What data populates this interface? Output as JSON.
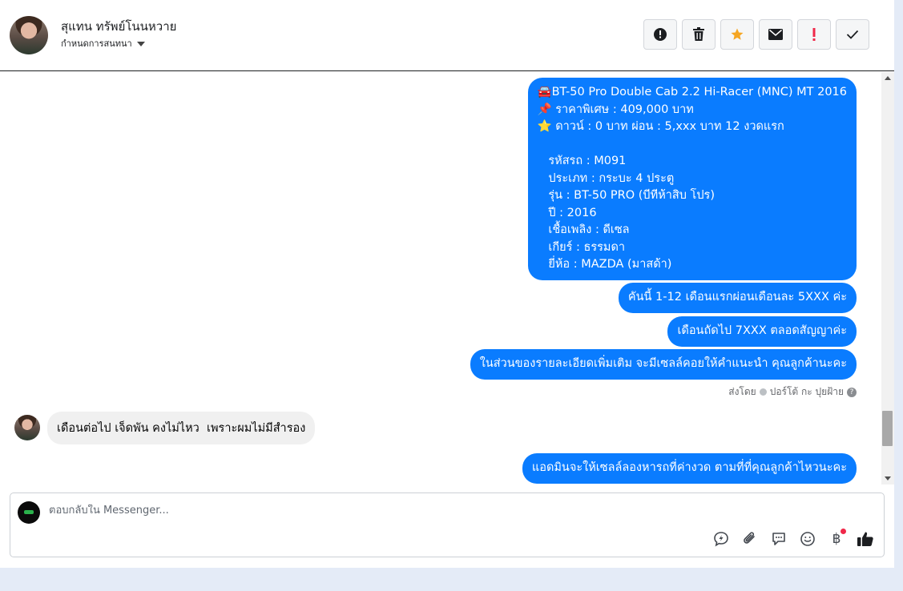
{
  "header": {
    "contact_name": "สุแทน ทรัพย์โนนหวาย",
    "assign_label": "กำหนดการสนทนา"
  },
  "toolbar": {
    "buttons": [
      {
        "name": "spam-button",
        "icon": "!",
        "color": "#1c1e21"
      },
      {
        "name": "delete-button",
        "icon": "🗑",
        "color": "#1c1e21"
      },
      {
        "name": "star-button",
        "icon": "★",
        "color": "#f5a623"
      },
      {
        "name": "mail-button",
        "icon": "✉",
        "color": "#1c1e21"
      },
      {
        "name": "important-button",
        "icon": "!",
        "color": "#f02849"
      },
      {
        "name": "done-button",
        "icon": "✓",
        "color": "#1c1e21"
      }
    ]
  },
  "messages": {
    "car_details": "🚘BT-50 Pro Double Cab 2.2 Hi-Racer (MNC) MT 2016\n📌 ราคาพิเศษ : 409,000 บาท\n⭐ ดาวน์ : 0 บาท ผ่อน : 5,xxx บาท 12 งวดแรก\n\n   รหัสรถ : M091\n   ประเภท : กระบะ 4 ประตู\n   รุ่น : BT-50 PRO (บีทีห้าสิบ โปร)\n   ปี : 2016\n   เชื้อเพลิง : ดีเซล\n   เกียร์ : ธรรมดา\n   ยี่ห้อ : MAZDA (มาสด้า)",
    "installment_first": "คันนี้ 1-12 เดือนแรกผ่อนเดือนละ 5XXX ค่ะ",
    "installment_next": "เดือนถัดไป 7XXX ตลอดสัญญาค่ะ",
    "details_note": "ในส่วนของรายละเอียดเพิ่มเติม จะมีเซลล์คอยให้คำแนะนำ คุณลูกค้านะคะ",
    "sent_by_label": "ส่งโดย",
    "sent_by_name": "ปอร์โต้ กะ ปุยฝ้าย",
    "customer_reply": "เดือนต่อไป เจ็ดพัน คงไม่ไหว  เพราะผมไม่มีสำรอง",
    "admin_reply": "แอดมินจะให้เซลล์ลองหารถที่ค่างวด ตามที่ที่คุณลูกค้าไหวนะคะ"
  },
  "composer": {
    "placeholder": "ตอบกลับใน Messenger..."
  },
  "icons": {
    "save_reply": "💬",
    "attach": "📎",
    "comments": "🗨",
    "emoji": "☺",
    "payment": "฿",
    "like": "👍"
  }
}
